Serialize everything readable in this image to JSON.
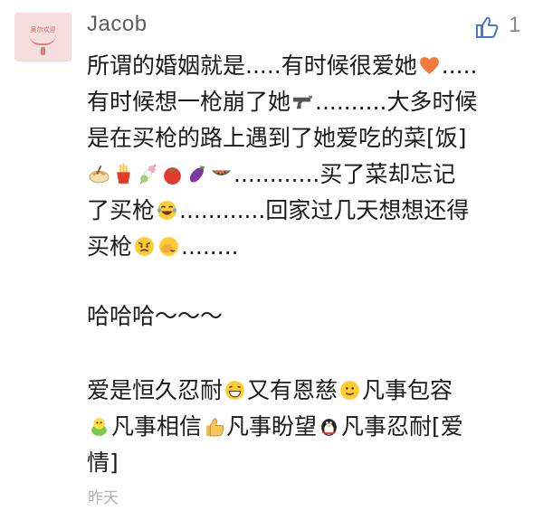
{
  "comment": {
    "avatar_text": "吴尔欢迎",
    "username": "Jacob",
    "like_count": "1",
    "lines": [
      [
        "所谓的婚姻就是.....有时候很爱她",
        ".....",
        "有时候想一枪崩了她",
        "..........大多时候",
        "是在买枪的路上遇到了她爱吃的菜[饭]",
        "............买了菜却忘记",
        "了买枪",
        "............回家过几天想想还得",
        "买枪",
        "........"
      ],
      "哈哈哈～～～",
      [
        "爱是恒久忍耐",
        "又有恩慈",
        "凡事包容",
        "凡事相信",
        "凡事盼望",
        "凡事忍耐[爱",
        "情]"
      ]
    ],
    "timestamp": "昨天"
  },
  "icons": [
    "thumbs-up-icon",
    "heart-icon",
    "pistol-icon",
    "noodle-icon",
    "fries-icon",
    "dango-icon",
    "tomato-icon",
    "eggplant-icon",
    "watermelon-icon",
    "laugh-cry-icon",
    "angry-icon",
    "face-palm-icon",
    "grin-icon",
    "smile-icon",
    "frog-icon",
    "thumb-emoji-icon",
    "penguin-icon"
  ]
}
